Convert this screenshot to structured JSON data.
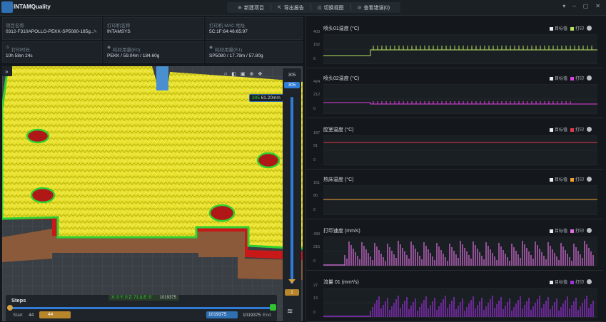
{
  "app": {
    "title": "INTAMQuality"
  },
  "menu": [
    {
      "icon": "plus-circle-icon",
      "glyph": "⊕",
      "label": "新建项目"
    },
    {
      "icon": "export-icon",
      "glyph": "⇱",
      "label": "导出报告"
    },
    {
      "icon": "view-switch-icon",
      "glyph": "⊡",
      "label": "切换视图"
    },
    {
      "icon": "error-icon",
      "glyph": "⊘",
      "label": "查看错误(0)"
    }
  ],
  "info": {
    "project_name_label": "项目名称",
    "project_name": "0312-F310APOLLO-PEKK-SP5080-185g...",
    "printer_name_label": "打印机名称",
    "printer_name": "INTAMSYS",
    "mac_label": "打印机 MAC 地址",
    "mac": "5C:1F:64:46:65:97",
    "print_time_label": "打印时长",
    "print_time": "10h 58m 24s",
    "material1_label": "耗材用量(E0)",
    "material1": "PEKK / 59.04m / 184.60g",
    "material2_label": "耗材用量(E1)",
    "material2": "SP5080 / 17.79m / 57.80g"
  },
  "viewer": {
    "layer_top": "305",
    "layer_current": "305",
    "layer_height": "61.20mm",
    "layer_bottom": "1",
    "coords": "X: 0  Y: 0  Z: 71  Δ.E: 0",
    "coord_value": "1019375"
  },
  "steps": {
    "title": "Steps",
    "start_label": "Start",
    "start_value": "44",
    "start_input": "44",
    "end_input": "1019375",
    "end_value": "1019375",
    "end_label": "End"
  },
  "colors": {
    "accent": "#2f7bd6",
    "bg": "#14181c"
  },
  "charts": [
    {
      "title": "喷头01温度 (°C)",
      "legend_a": "目标值",
      "legend_b": "打印",
      "color": "#b5e35a",
      "y_labels": [
        "403",
        "162",
        "0"
      ]
    },
    {
      "title": "喷头02温度 (°C)",
      "legend_a": "目标值",
      "legend_b": "打印",
      "color": "#e040e0",
      "y_labels": [
        "424",
        "212",
        "0"
      ]
    },
    {
      "title": "腔室温度 (°C)",
      "legend_a": "目标值",
      "legend_b": "打印",
      "color": "#e03a4a",
      "y_labels": [
        "187",
        "91",
        "0"
      ]
    },
    {
      "title": "热床温度 (°C)",
      "legend_a": "目标值",
      "legend_b": "打印",
      "color": "#f0a030",
      "y_labels": [
        "161",
        "80",
        "0"
      ]
    },
    {
      "title": "打印速度 (mm/s)",
      "legend_a": "目标值",
      "legend_b": "打印",
      "color": "#e070e0",
      "y_labels": [
        "430",
        "215",
        "0"
      ]
    },
    {
      "title": "流量 01 (mm³/s)",
      "legend_a": "目标值",
      "legend_b": "打印",
      "color": "#a030e0",
      "y_labels": [
        "27",
        "13",
        "0"
      ]
    }
  ]
}
